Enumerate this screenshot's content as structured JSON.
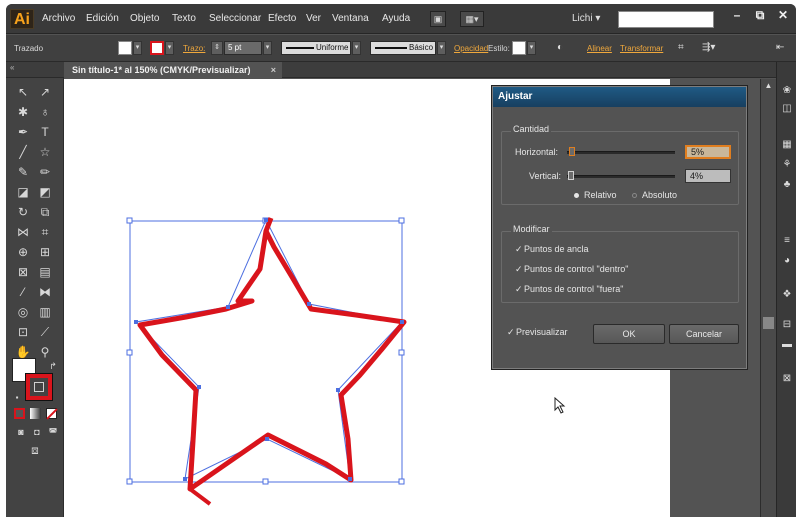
{
  "app": {
    "logo": "Ai",
    "menu": [
      "Archivo",
      "Edición",
      "Objeto",
      "Texto",
      "Seleccionar",
      "Efecto",
      "Ver",
      "Ventana",
      "Ayuda"
    ],
    "workspace": "Lichi ▾",
    "window_controls": [
      "–",
      "⧉",
      "✕"
    ]
  },
  "control_bar": {
    "selection_label": "Trazado",
    "stroke_label": "Trazo:",
    "stroke_weight": "5 pt",
    "variable_width": "Uniforme",
    "brush": "Básico",
    "opacity_label": "Opacidad",
    "style_label": "Estilo:",
    "align_label": "Alinear",
    "transform_label": "Transformar",
    "stroke_color": "#d9141c"
  },
  "document_tab": {
    "title": "Sin título-1* al 150% (CMYK/Previsualizar)",
    "close": "×"
  },
  "dialog": {
    "title": "Ajustar",
    "quantity_group": "Cantidad",
    "horizontal_label": "Horizontal:",
    "horizontal_value": "5%",
    "horizontal_level": 0.05,
    "vertical_label": "Vertical:",
    "vertical_value": "4%",
    "vertical_level": 0.04,
    "relative_label": "Relativo",
    "absolute_label": "Absoluto",
    "relative_selected": true,
    "modify_group": "Modificar",
    "options": [
      {
        "label": "Puntos de ancla",
        "checked": true
      },
      {
        "label": "Puntos de control \"dentro\"",
        "checked": true
      },
      {
        "label": "Puntos de control \"fuera\"",
        "checked": true
      }
    ],
    "preview_label": "Previsualizar",
    "preview_checked": true,
    "ok_label": "OK",
    "cancel_label": "Cancelar"
  },
  "colors": {
    "star_stroke": "#d9141c",
    "selection": "#4d6fe0",
    "dialog_title": "#1f5a84",
    "accent": "#e07e1f"
  }
}
